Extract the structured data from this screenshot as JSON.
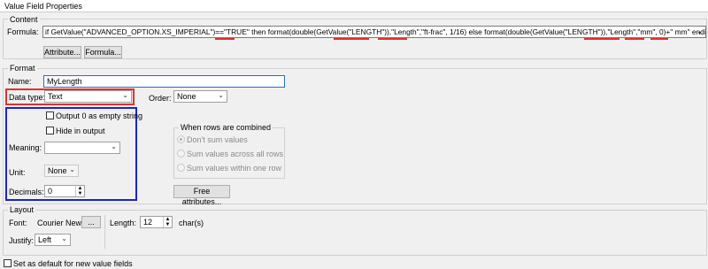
{
  "window": {
    "title": "Value Field Properties"
  },
  "content": {
    "group_label": "Content",
    "formula_label": "Formula:",
    "formula": {
      "parts": [
        "if GetValue(\"ADVANCED_OPTION.XS_IMPERIAL\")==",
        "\"TRUE\"",
        " then format(double(GetValue(\"LENGTH\")),\"",
        "Length",
        "\",\"",
        "ft-frac",
        "\", 1/16) else format(double(GetValue(\"LENGTH\")),\"",
        "Length",
        "\",\"",
        "mm",
        "\", 0)+\"",
        " mm",
        "\" endif"
      ]
    },
    "attribute_button": "Attribute...",
    "formula_button": "Formula..."
  },
  "format": {
    "group_label": "Format",
    "name_label": "Name:",
    "name_value": "MyLength",
    "data_type_label": "Data type:",
    "data_type_value": "Text",
    "order_label": "Order:",
    "order_value": "None",
    "output_zero_label": "Output 0 as empty string",
    "hide_label": "Hide in output",
    "meaning_label": "Meaning:",
    "meaning_value": "",
    "unit_label": "Unit:",
    "unit_value": "None",
    "decimals_label": "Decimals:",
    "decimals_value": "0",
    "combine": {
      "label": "When rows are combined",
      "options": [
        "Don't sum values",
        "Sum values across all rows",
        "Sum values within one row"
      ],
      "selected_index": 0
    },
    "free_attributes_button": "Free attributes..."
  },
  "layout": {
    "group_label": "Layout",
    "font_label": "Font:",
    "font_value": "Courier New",
    "font_button": "...",
    "length_label": "Length:",
    "length_value": "12",
    "length_unit": "char(s)",
    "justify_label": "Justify:",
    "justify_value": "Left"
  },
  "footer": {
    "default_label": "Set as default for new value fields"
  },
  "annotation_colors": {
    "red": "#e03030",
    "blue": "#1a22d0"
  }
}
